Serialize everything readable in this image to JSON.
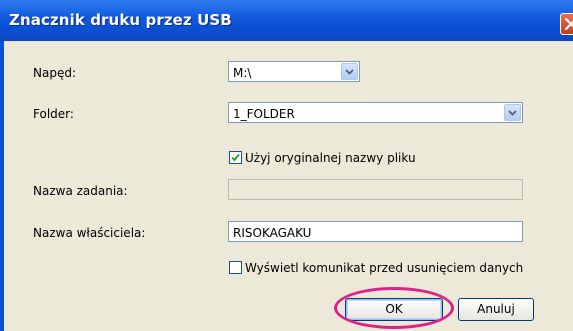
{
  "window": {
    "title": "Znacznik druku przez USB"
  },
  "form": {
    "drive_label": "Napęd:",
    "drive_value": "M:\\",
    "folder_label": "Folder:",
    "folder_value": "1_FOLDER",
    "use_original_name_label": "Użyj oryginalnej nazwy pliku",
    "use_original_name_checked": true,
    "job_name_label": "Nazwa zadania:",
    "job_name_value": "",
    "owner_name_label": "Nazwa właściciela:",
    "owner_name_value": "RISOKAGAKU",
    "show_message_label": "Wyświetl komunikat przed usunięciem danych",
    "show_message_checked": false
  },
  "buttons": {
    "ok_label": "OK",
    "cancel_label": "Anuluj"
  },
  "colors": {
    "titlebar": "#0a47c6",
    "dialog_background": "#ece9d8",
    "highlight_ring": "#e0208a"
  },
  "icons": {
    "close": "close-icon",
    "dropdown": "chevron-down-icon",
    "check": "checkmark-icon"
  }
}
